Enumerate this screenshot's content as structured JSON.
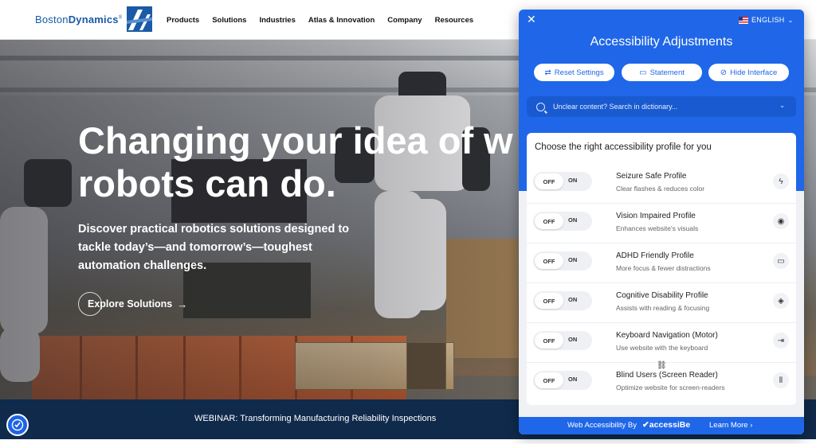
{
  "header": {
    "brand_light": "Boston",
    "brand_bold": "Dynamics",
    "brand_mark": "®",
    "nav": [
      "Products",
      "Solutions",
      "Industries",
      "Atlas & Innovation",
      "Company",
      "Resources"
    ]
  },
  "hero": {
    "title_line1": "Changing your idea of w",
    "title_line2": "robots can do.",
    "subtitle": "Discover practical robotics solutions designed to tackle today’s—and tomorrow’s—toughest automation challenges.",
    "cta_label": "Explore Solutions",
    "cta_arrow": "→"
  },
  "webinar": {
    "text": "WEBINAR: Transforming Manufacturing Reliability Inspections"
  },
  "accessibility_panel": {
    "close_glyph": "✕",
    "language": "ENGLISH",
    "title": "Accessibility Adjustments",
    "buttons": {
      "reset": "Reset Settings",
      "statement": "Statement",
      "hide": "Hide Interface"
    },
    "search_placeholder": "Unclear content? Search in dictionary...",
    "profiles_heading": "Choose the right accessibility profile for you",
    "toggle_off": "OFF",
    "toggle_on": "ON",
    "profiles": [
      {
        "name": "Seizure Safe Profile",
        "desc": "Clear flashes & reduces color",
        "icon": "lightning-icon",
        "glyph": "ϟ",
        "enabled": false
      },
      {
        "name": "Vision Impaired Profile",
        "desc": "Enhances website's visuals",
        "icon": "eye-icon",
        "glyph": "◉",
        "enabled": false
      },
      {
        "name": "ADHD Friendly Profile",
        "desc": "More focus & fewer distractions",
        "icon": "focus-icon",
        "glyph": "▭",
        "enabled": false
      },
      {
        "name": "Cognitive Disability Profile",
        "desc": "Assists with reading & focusing",
        "icon": "target-icon",
        "glyph": "◈",
        "enabled": false
      },
      {
        "name": "Keyboard Navigation (Motor)",
        "desc": "Use website with the keyboard",
        "icon": "arrow-to-line-icon",
        "glyph": "⇥",
        "enabled": false
      },
      {
        "name": "Blind Users (Screen Reader)",
        "desc": "Optimize website for screen-readers",
        "icon": "sound-wave-icon",
        "glyph": "⦀",
        "enabled": false
      }
    ],
    "footer": {
      "label": "Web Accessibility By",
      "brand": "✔accessiBe",
      "learn_more": "Learn More ›"
    }
  },
  "colors": {
    "panel_blue": "#1f67e8",
    "webinar_bg": "#0f2a4b",
    "logo_blue": "#1b5aa6"
  }
}
